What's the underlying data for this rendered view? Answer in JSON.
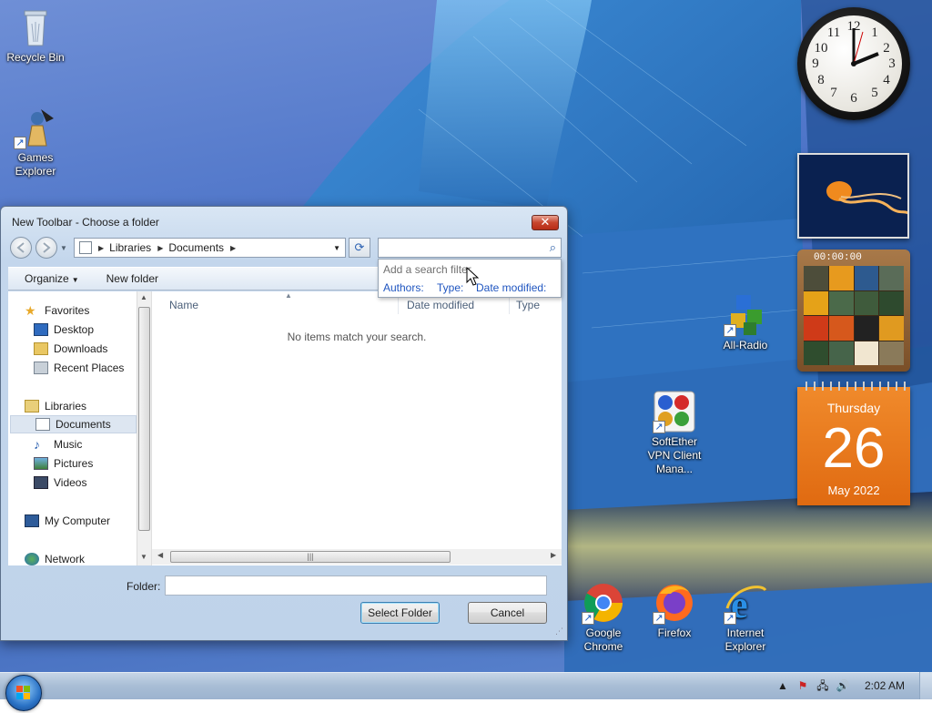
{
  "desktop": {
    "icons": [
      {
        "label": "Recycle Bin",
        "icon": "recycle-bin-icon"
      },
      {
        "label": "Games Explorer",
        "icon": "games-explorer-icon"
      },
      {
        "label": "All-Radio",
        "icon": "all-radio-icon"
      },
      {
        "label": "SoftEther VPN Client Mana...",
        "icon": "softether-vpn-icon"
      },
      {
        "label": "Google Chrome",
        "icon": "chrome-icon"
      },
      {
        "label": "Firefox",
        "icon": "firefox-icon"
      },
      {
        "label": "Internet Explorer",
        "icon": "internet-explorer-icon"
      }
    ]
  },
  "gadgets": {
    "clock": {
      "time": "2:02",
      "numbers": [
        "12",
        "1",
        "2",
        "3",
        "4",
        "5",
        "6",
        "7",
        "8",
        "9",
        "10",
        "11"
      ]
    },
    "puzzle": {
      "timer": "00:00:00"
    },
    "calendar": {
      "weekday": "Thursday",
      "day": "26",
      "month_year": "May 2022"
    }
  },
  "dialog": {
    "title": "New Toolbar - Choose a folder",
    "close_label": "✕",
    "address": {
      "crumbs": [
        "Libraries",
        "Documents"
      ]
    },
    "search": {
      "value": "",
      "popup_hint": "Add a search filter",
      "filters": [
        "Authors:",
        "Type:",
        "Date modified:"
      ]
    },
    "commands": {
      "organize": "Organize",
      "new_folder": "New folder"
    },
    "nav": {
      "favorites": "Favorites",
      "desktop": "Desktop",
      "downloads": "Downloads",
      "recent": "Recent Places",
      "libraries": "Libraries",
      "documents": "Documents",
      "music": "Music",
      "pictures": "Pictures",
      "videos": "Videos",
      "my_computer": "My Computer",
      "network": "Network"
    },
    "columns": {
      "name": "Name",
      "date": "Date modified",
      "type": "Type"
    },
    "empty_message": "No items match your search.",
    "folder_label": "Folder:",
    "folder_value": "",
    "select_button": "Select Folder",
    "cancel_button": "Cancel"
  },
  "taskbar": {
    "time": "2:02 AM"
  },
  "colors": {
    "accent": "#2b73c6",
    "link": "#1f55c0",
    "calendar": "#e06a11"
  }
}
